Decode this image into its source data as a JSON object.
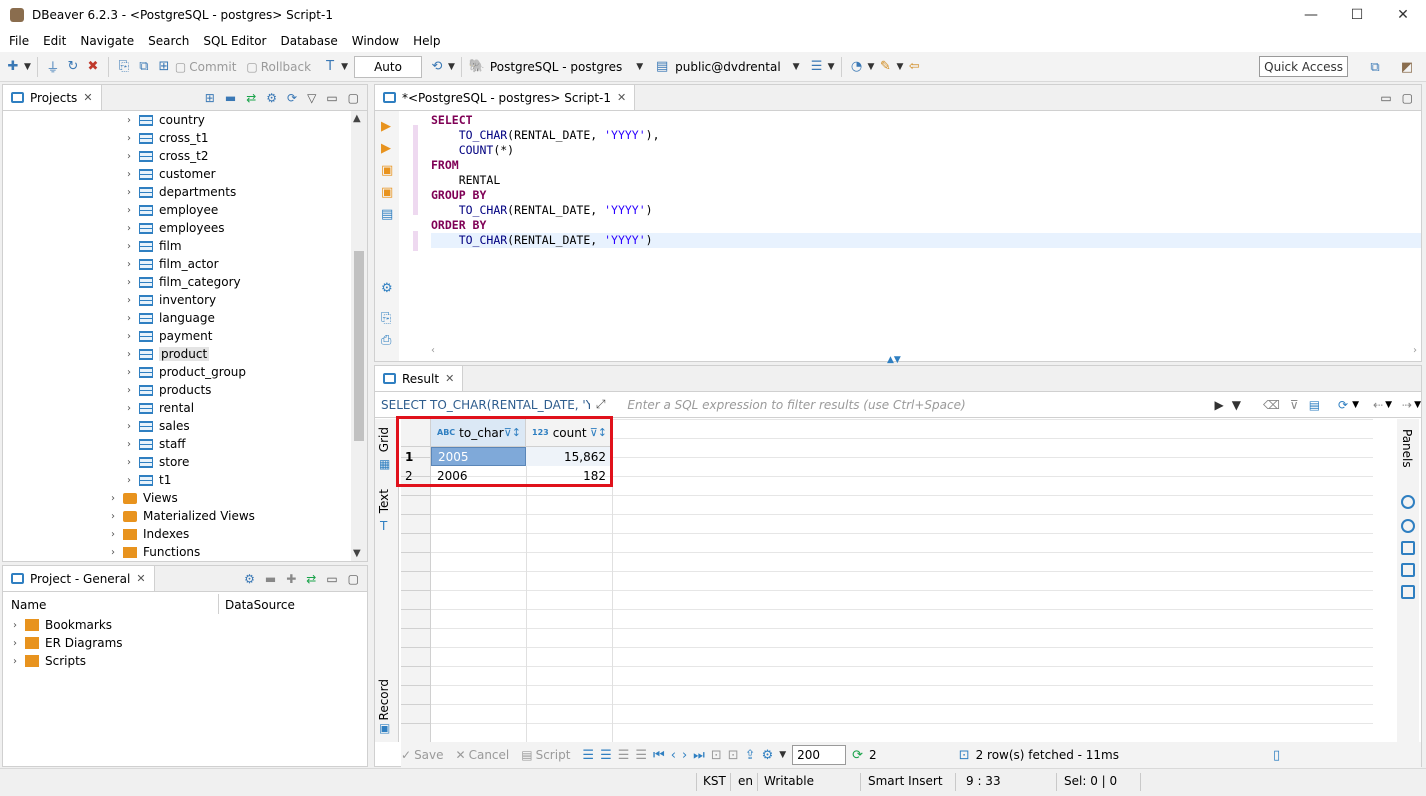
{
  "window": {
    "title": "DBeaver 6.2.3 - <PostgreSQL - postgres> Script-1",
    "controls": [
      "—",
      "☐",
      "✕"
    ]
  },
  "menu": [
    "File",
    "Edit",
    "Navigate",
    "Search",
    "SQL Editor",
    "Database",
    "Window",
    "Help"
  ],
  "toolbar": {
    "commit": "Commit",
    "rollback": "Rollback",
    "transaction_mode": "Auto",
    "connection": "PostgreSQL - postgres",
    "schema": "public@dvdrental",
    "quick_access": "Quick Access"
  },
  "projects_panel": {
    "tab_label": "Projects",
    "tree": [
      {
        "label": "country",
        "kind": "table",
        "expanded": false
      },
      {
        "label": "cross_t1",
        "kind": "table",
        "expanded": false
      },
      {
        "label": "cross_t2",
        "kind": "table",
        "expanded": false
      },
      {
        "label": "customer",
        "kind": "table",
        "expanded": false
      },
      {
        "label": "departments",
        "kind": "table",
        "expanded": false
      },
      {
        "label": "employee",
        "kind": "table",
        "expanded": false
      },
      {
        "label": "employees",
        "kind": "table",
        "expanded": false
      },
      {
        "label": "film",
        "kind": "table",
        "expanded": false
      },
      {
        "label": "film_actor",
        "kind": "table",
        "expanded": false
      },
      {
        "label": "film_category",
        "kind": "table",
        "expanded": false
      },
      {
        "label": "inventory",
        "kind": "table",
        "expanded": false
      },
      {
        "label": "language",
        "kind": "table",
        "expanded": false
      },
      {
        "label": "payment",
        "kind": "table",
        "expanded": false
      },
      {
        "label": "product",
        "kind": "table",
        "expanded": false,
        "selected": true
      },
      {
        "label": "product_group",
        "kind": "table",
        "expanded": false
      },
      {
        "label": "products",
        "kind": "table",
        "expanded": false
      },
      {
        "label": "rental",
        "kind": "table",
        "expanded": false
      },
      {
        "label": "sales",
        "kind": "table",
        "expanded": false
      },
      {
        "label": "staff",
        "kind": "table",
        "expanded": false
      },
      {
        "label": "store",
        "kind": "table",
        "expanded": false
      },
      {
        "label": "t1",
        "kind": "table",
        "expanded": false
      },
      {
        "label": "Views",
        "kind": "views",
        "expanded": false
      },
      {
        "label": "Materialized Views",
        "kind": "views",
        "expanded": false
      },
      {
        "label": "Indexes",
        "kind": "folder",
        "expanded": false
      },
      {
        "label": "Functions",
        "kind": "folder",
        "expanded": false
      }
    ]
  },
  "project_general": {
    "tab_label": "Project - General",
    "columns": [
      "Name",
      "DataSource"
    ],
    "items": [
      "Bookmarks",
      "ER Diagrams",
      "Scripts"
    ]
  },
  "editor": {
    "tab_label": "*<PostgreSQL - postgres> Script-1",
    "code_lines": [
      {
        "indent": "",
        "kw": "SELECT",
        "rest": ""
      },
      {
        "indent": "    ",
        "fn": "TO_CHAR",
        "args": "(RENTAL_DATE, ",
        "str": "'YYYY'",
        "tail": "),"
      },
      {
        "indent": "    ",
        "fn": "COUNT",
        "args": "(*)",
        "str": "",
        "tail": ""
      },
      {
        "indent": "",
        "kw": "FROM",
        "rest": ""
      },
      {
        "indent": "    ",
        "plain": "RENTAL"
      },
      {
        "indent": "",
        "kw": "GROUP BY",
        "rest": ""
      },
      {
        "indent": "    ",
        "fn": "TO_CHAR",
        "args": "(RENTAL_DATE, ",
        "str": "'YYYY'",
        "tail": ")"
      },
      {
        "indent": "",
        "kw": "ORDER BY",
        "rest": ""
      },
      {
        "indent": "    ",
        "fn": "TO_CHAR",
        "args": "(RENTAL_DATE, ",
        "str": "'YYYY'",
        "tail": ")",
        "current": true
      }
    ]
  },
  "result": {
    "tab_label": "Result",
    "query_text": "SELECT TO_CHAR(RENTAL_DATE, 'YYYY'), C",
    "filter_placeholder": "Enter a SQL expression to filter results (use Ctrl+Space)",
    "side_tabs": [
      "Grid",
      "Text",
      "Record"
    ],
    "right_label": "Panels",
    "columns": [
      {
        "type": "ABC",
        "name": "to_char"
      },
      {
        "type": "123",
        "name": "count"
      }
    ],
    "rows": [
      {
        "num": "1",
        "to_char": "2005",
        "count": "15,862"
      },
      {
        "num": "2",
        "to_char": "2006",
        "count": "182"
      }
    ],
    "footer": {
      "save": "Save",
      "cancel": "Cancel",
      "script": "Script",
      "fetch_size": "200",
      "row_count": "2",
      "status": "2 row(s) fetched - 11ms"
    }
  },
  "statusbar": {
    "timezone": "KST",
    "locale": "en",
    "mode": "Writable",
    "insert": "Smart Insert",
    "position": "9 : 33",
    "selection": "Sel: 0 | 0"
  },
  "colors": {
    "accent": "#2f7fc1",
    "keyword": "#7f0055",
    "string": "#2a00ff",
    "highlight_box": "#e0111b",
    "selected_cell": "#7fa9d9"
  }
}
